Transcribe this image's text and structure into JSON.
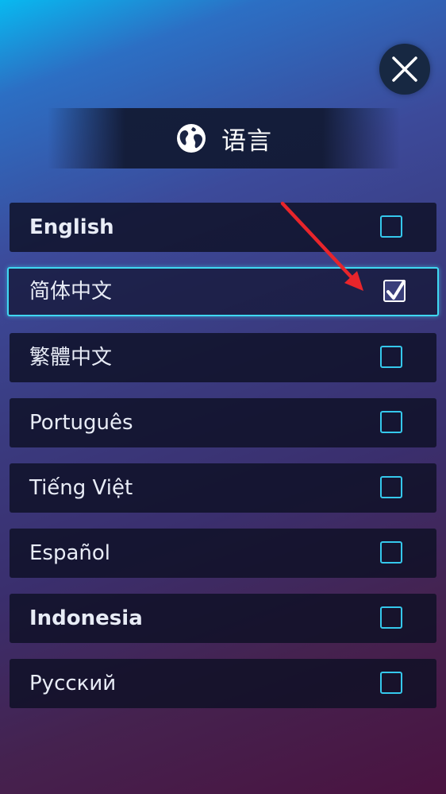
{
  "header": {
    "title": "语言",
    "globe_icon": "globe-icon",
    "close_icon": "close-icon"
  },
  "languages": [
    {
      "label": "English",
      "checked": false
    },
    {
      "label": "简体中文",
      "checked": true
    },
    {
      "label": "繁體中文",
      "checked": false
    },
    {
      "label": "Português",
      "checked": false
    },
    {
      "label": "Tiếng Việt",
      "checked": false
    },
    {
      "label": "Español",
      "checked": false
    },
    {
      "label": "Indonesia",
      "checked": false
    },
    {
      "label": "Русский",
      "checked": false
    }
  ],
  "colors": {
    "accent": "#3fd8f2",
    "checkbox_border": "#35c8ec",
    "annotation_arrow": "#e8252b",
    "row_bg": "#0e1024",
    "close_bg": "#172842"
  }
}
